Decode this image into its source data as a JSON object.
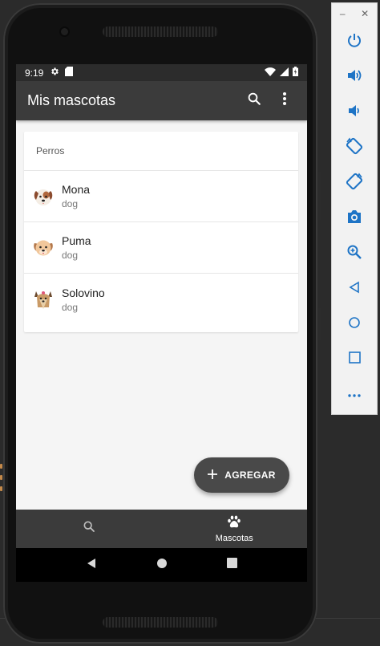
{
  "status_bar": {
    "time": "9:19"
  },
  "app_bar": {
    "title": "Mis mascotas",
    "search_icon": "search-icon",
    "overflow_icon": "more-vert-icon"
  },
  "section": {
    "header": "Perros"
  },
  "pets": [
    {
      "name": "Mona",
      "kind": "dog",
      "avatar": "dog-white-brown"
    },
    {
      "name": "Puma",
      "kind": "dog",
      "avatar": "dog-beige"
    },
    {
      "name": "Solovino",
      "kind": "dog",
      "avatar": "dog-yorkie"
    }
  ],
  "fab": {
    "label": "AGREGAR",
    "icon": "plus-icon"
  },
  "bottom_nav": [
    {
      "label": "",
      "icon": "search-icon",
      "active": false
    },
    {
      "label": "Mascotas",
      "icon": "paw-icon",
      "active": true
    }
  ],
  "emulator_toolbar": {
    "window_controls": [
      "–",
      "✕"
    ],
    "tools": [
      "power",
      "volume-up",
      "volume-down",
      "rotate-left",
      "rotate-right",
      "screenshot",
      "zoom",
      "back",
      "home",
      "overview",
      "more"
    ]
  },
  "colors": {
    "app_bar": "#3b3b3b",
    "status_bar": "#2c2c2c",
    "fab": "#494949",
    "screen_bg": "#f5f5f5",
    "emulator_icons": "#1e74c6"
  }
}
